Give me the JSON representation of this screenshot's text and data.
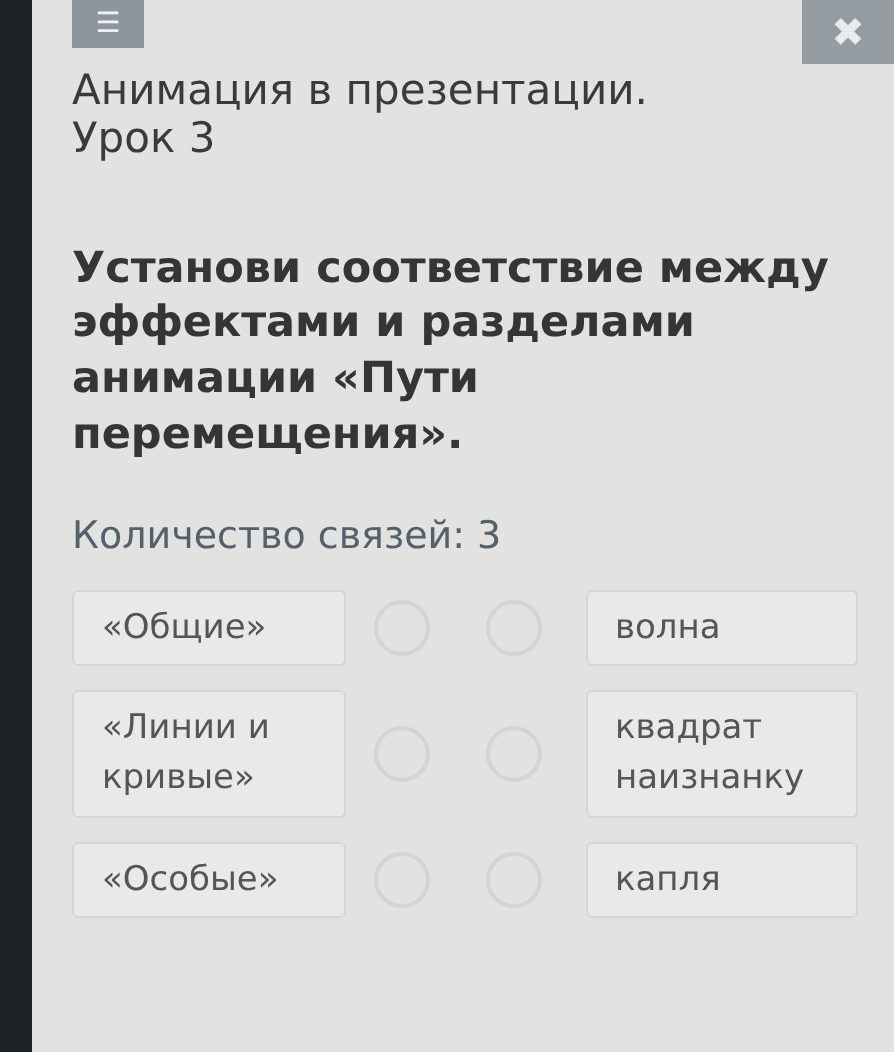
{
  "header": {
    "menu_button": "☰",
    "close_button": "✖"
  },
  "title": "Анимация в презентации. Урок 3",
  "instruction": "Установи соответствие между эффектами и разделами анимации «Пути перемещения».",
  "links_count": "Количество связей: 3",
  "pairs": [
    {
      "left": "«Общие»",
      "right": "волна"
    },
    {
      "left": "«Линии и кривые»",
      "right": "квадрат наизнанку"
    },
    {
      "left": "«Особые»",
      "right": "капля"
    }
  ]
}
